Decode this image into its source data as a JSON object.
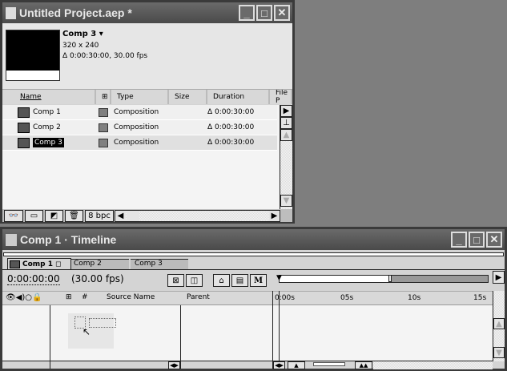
{
  "project": {
    "title": "Untitled Project.aep *",
    "preview": {
      "name": "Comp 3 ▾",
      "size": "320 x 240",
      "duration": "Δ 0:00:30:00, 30.00 fps"
    },
    "columns": [
      "Name",
      "Type",
      "Size",
      "Duration",
      "File P"
    ],
    "items": [
      {
        "name": "Comp 1",
        "type": "Composition",
        "duration": "Δ 0:00:30:00"
      },
      {
        "name": "Comp 2",
        "type": "Composition",
        "duration": "Δ 0:00:30:00"
      },
      {
        "name": "Comp 3",
        "type": "Composition",
        "duration": "Δ 0:00:30:00"
      }
    ],
    "bpc": "8 bpc"
  },
  "timeline": {
    "title": "Comp 1 · Timeline",
    "tabs": [
      "Comp 1",
      "Comp 2",
      "Comp 3"
    ],
    "timecode": "0:00:00:00",
    "fps": "(30.00 fps)",
    "columns": {
      "hash": "#",
      "source": "Source Name",
      "parent": "Parent"
    },
    "ruler": [
      "0:00s",
      "05s",
      "10s",
      "15s"
    ],
    "motion_blur_label": "M"
  }
}
